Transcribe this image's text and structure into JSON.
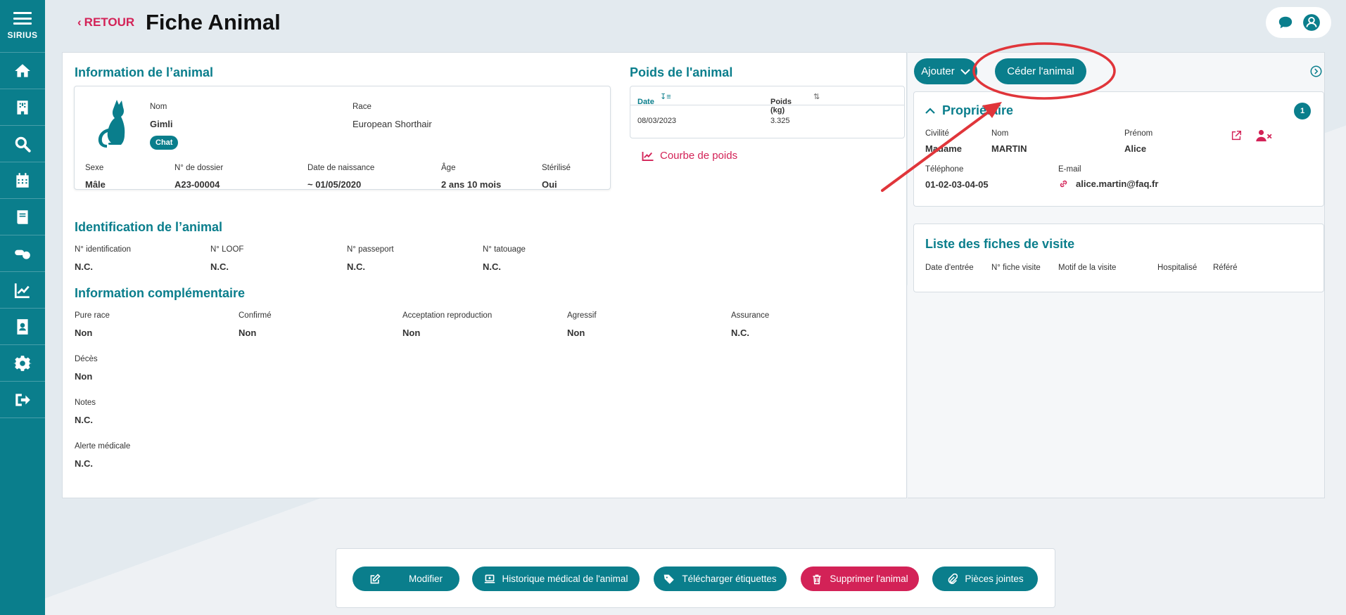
{
  "sidebar": {
    "brand": "SIRIUS",
    "items": [
      {
        "icon": "home-icon"
      },
      {
        "icon": "building-icon"
      },
      {
        "icon": "search-icon"
      },
      {
        "icon": "calendar-icon"
      },
      {
        "icon": "book-icon"
      },
      {
        "icon": "pills-icon"
      },
      {
        "icon": "chart-line-icon"
      },
      {
        "icon": "address-book-icon"
      },
      {
        "icon": "gear-icon"
      },
      {
        "icon": "logout-icon"
      }
    ]
  },
  "header": {
    "back_label": "RETOUR",
    "title": "Fiche Animal"
  },
  "animal_info": {
    "section_title": "Information de l’animal",
    "nom_label": "Nom",
    "nom_value": "Gimli",
    "species_badge": "Chat",
    "race_label": "Race",
    "race_value": "European Shorthair",
    "sexe_label": "Sexe",
    "sexe_value": "Mâle",
    "dossier_label": "N° de dossier",
    "dossier_value": "A23-00004",
    "naissance_label": "Date de naissance",
    "naissance_value": "~ 01/05/2020",
    "age_label": "Âge",
    "age_value": "2 ans 10 mois",
    "sterilise_label": "Stérilisé",
    "sterilise_value": "Oui"
  },
  "weight": {
    "section_title": "Poids de l'animal",
    "col_date": "Date",
    "col_poids": "Poids (kg)",
    "rows": [
      {
        "date": "08/03/2023",
        "poids": "3.325"
      }
    ],
    "courbe_label": "Courbe de poids"
  },
  "identification": {
    "section_title": "Identification de l’animal",
    "fields": [
      {
        "label": "N° identification",
        "value": "N.C."
      },
      {
        "label": "N° LOOF",
        "value": "N.C."
      },
      {
        "label": "N° passeport",
        "value": "N.C."
      },
      {
        "label": "N° tatouage",
        "value": "N.C."
      }
    ]
  },
  "complementaire": {
    "section_title": "Information complémentaire",
    "row1": [
      {
        "label": "Pure race",
        "value": "Non"
      },
      {
        "label": "Confirmé",
        "value": "Non"
      },
      {
        "label": "Acceptation reproduction",
        "value": "Non"
      },
      {
        "label": "Agressif",
        "value": "Non"
      },
      {
        "label": "Assurance",
        "value": "N.C."
      }
    ],
    "deces_label": "Décès",
    "deces_value": "Non",
    "notes_label": "Notes",
    "notes_value": "N.C.",
    "alerte_label": "Alerte médicale",
    "alerte_value": "N.C."
  },
  "right": {
    "ajouter_label": "Ajouter",
    "ceder_label": "Céder l'animal",
    "owner": {
      "section_title": "Propriétaire",
      "count": "1",
      "civilite_label": "Civilité",
      "civilite_value": "Madame",
      "nom_label": "Nom",
      "nom_value": "MARTIN",
      "prenom_label": "Prénom",
      "prenom_value": "Alice",
      "tel_label": "Téléphone",
      "tel_value": "01-02-03-04-05",
      "email_label": "E-mail",
      "email_value": "alice.martin@faq.fr"
    },
    "visits": {
      "section_title": "Liste des fiches de visite",
      "columns": [
        "Date d'entrée",
        "N° fiche visite",
        "Motif de la visite",
        "Hospitalisé",
        "Référé"
      ]
    }
  },
  "actions": {
    "modifier": "Modifier",
    "historique": "Historique médical de l'animal",
    "etiquettes": "Télécharger étiquettes",
    "supprimer": "Supprimer l'animal",
    "pieces": "Pièces jointes"
  },
  "colors": {
    "teal": "#0a7e8c",
    "accent_red": "#d32257",
    "annotation_red": "#e0353a"
  }
}
